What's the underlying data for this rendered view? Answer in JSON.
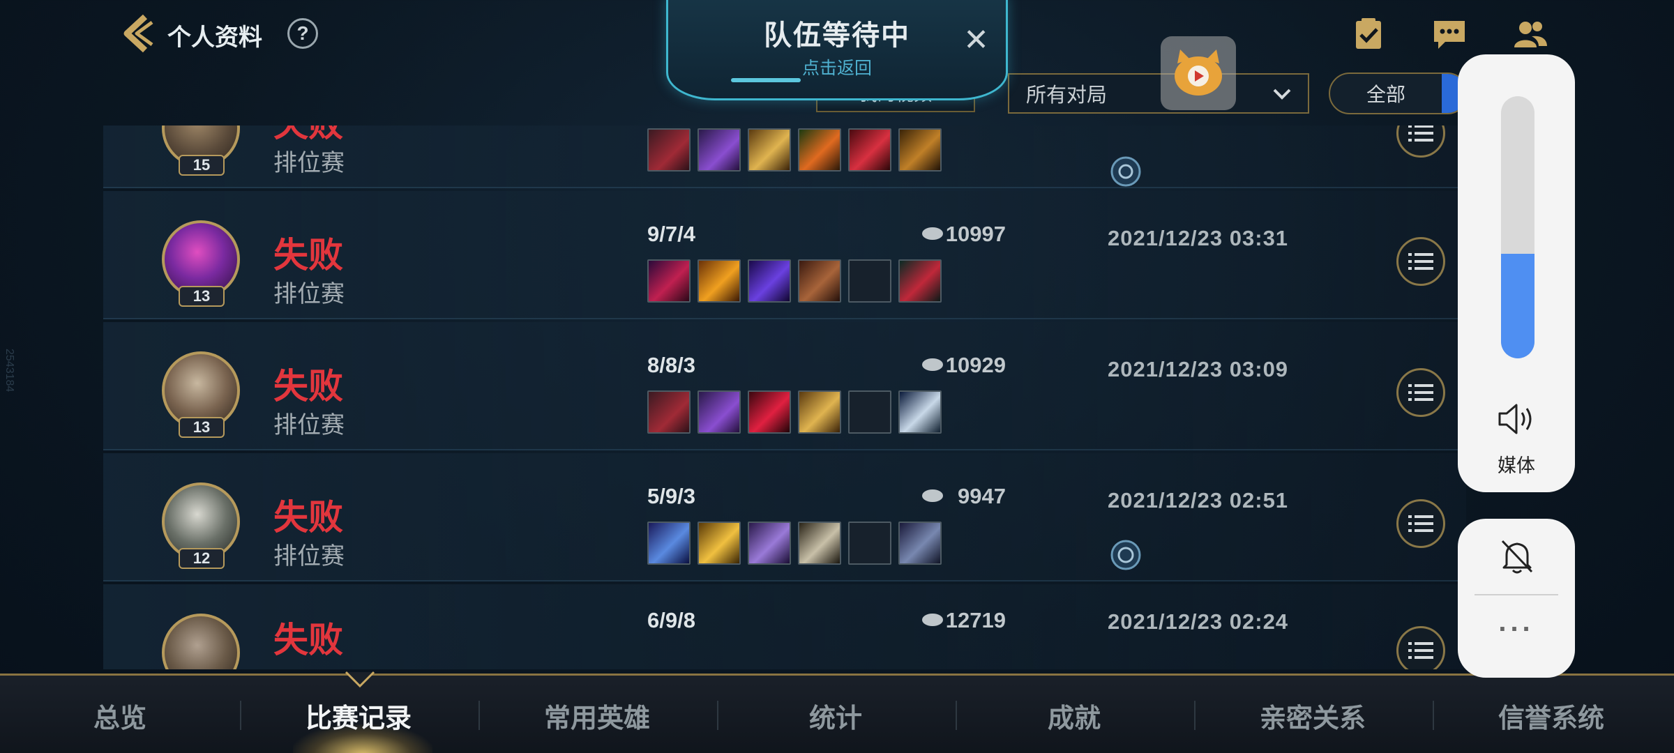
{
  "header": {
    "title": "个人资料",
    "help": "?",
    "my_video": "我的视频",
    "filter_value": "所有对局",
    "toggle_option": "全部"
  },
  "banner": {
    "title": "队伍等待中",
    "subtitle": "点击返回",
    "close": "✕"
  },
  "matches": [
    {
      "result": "失败",
      "mode": "排位赛",
      "level": "15",
      "kda": "",
      "gold": "",
      "time": ""
    },
    {
      "result": "失败",
      "mode": "排位赛",
      "level": "13",
      "kda": "9/7/4",
      "gold": "10997",
      "time": "2021/12/23 03:31"
    },
    {
      "result": "失败",
      "mode": "排位赛",
      "level": "13",
      "kda": "8/8/3",
      "gold": "10929",
      "time": "2021/12/23 03:09"
    },
    {
      "result": "失败",
      "mode": "排位赛",
      "level": "12",
      "kda": "5/9/3",
      "gold": "9947",
      "time": "2021/12/23 02:51"
    },
    {
      "result": "失败",
      "mode": "",
      "level": "",
      "kda": "6/9/8",
      "gold": "12719",
      "time": "2021/12/23 02:24"
    }
  ],
  "tabs": [
    "总览",
    "比赛记录",
    "常用英雄",
    "统计",
    "成就",
    "亲密关系",
    "信誉系统"
  ],
  "active_tab": "比赛记录",
  "volume": {
    "label": "媒体",
    "level": 0.4,
    "more": "..."
  },
  "colors": {
    "loss_red": "#e2363d",
    "gold_border": "#b69a5c",
    "banner_cyan": "#3fb7cf",
    "volume_blue": "#4f8ff2"
  },
  "watermark": "2543184"
}
